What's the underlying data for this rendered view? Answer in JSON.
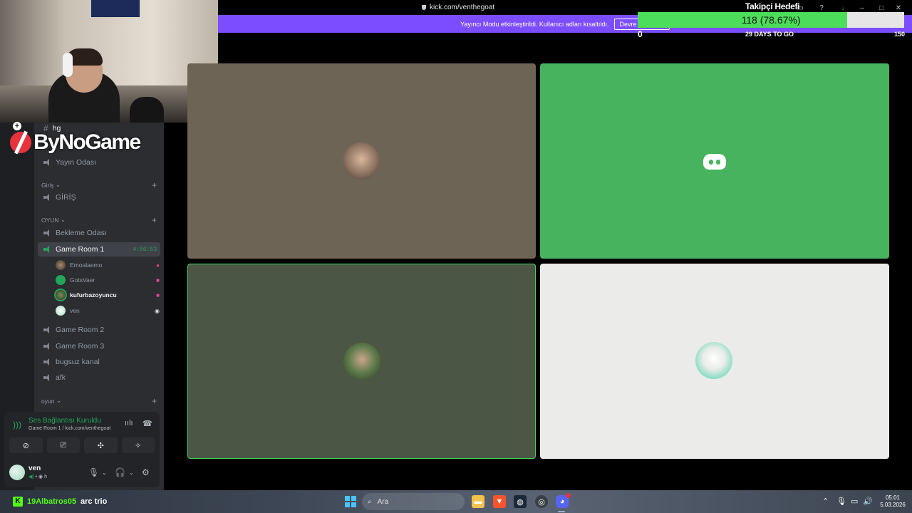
{
  "browser": {
    "url": "kick.com/venthegoat"
  },
  "stream_mode_bar": {
    "message": "Yayıncı Modu etkinleştirildi. Kullanıcı adları kısaltıldı.",
    "button": "Devre dışı bırak"
  },
  "follower_goal": {
    "title": "Takipçi Hedefi",
    "progress_text": "118 (78.67%)",
    "progress_fraction": 0.7867,
    "min": "0",
    "max": "150",
    "days_left": "29 DAYS TO GO"
  },
  "overlay_logo": {
    "text": "ByNoGame"
  },
  "sidebar": {
    "top_channel": "hg",
    "channels_top": [
      {
        "label": "Yayın Odası"
      }
    ],
    "category_giris": "Giriş",
    "channel_giris": "GİRİŞ",
    "category_oyun": "OYUN",
    "channel_bekleme": "Bekleme Odası",
    "active_channel": "Game Room 1",
    "active_timer": "4:56:53",
    "voice_users": [
      {
        "name": "Emoalaemo"
      },
      {
        "name": "GotsVaer"
      },
      {
        "name": "kufurbazoyuncu"
      },
      {
        "name": "ven"
      }
    ],
    "channels_bottom": [
      {
        "label": "Game Room 2"
      },
      {
        "label": "Game Room 3"
      },
      {
        "label": "bugsuz kanal"
      },
      {
        "label": "afk"
      }
    ],
    "category_oyun2": "oyun"
  },
  "voice_panel": {
    "status": "Ses Bağlantısı Kuruldu",
    "subtitle": "Game Room 1 / kick.com/venthegoat"
  },
  "user_panel": {
    "name": "ven",
    "status": "h"
  },
  "colors": {
    "accent": "#7c4dff",
    "discord_green": "#23a55a",
    "goal_fill": "#4cde5a",
    "kick_green": "#53fc18"
  },
  "taskbar": {
    "stream_user": "19Albatros05",
    "stream_title": "arc trio",
    "search_placeholder": "Ara",
    "time": "05:01",
    "date": "5.03.2026"
  }
}
